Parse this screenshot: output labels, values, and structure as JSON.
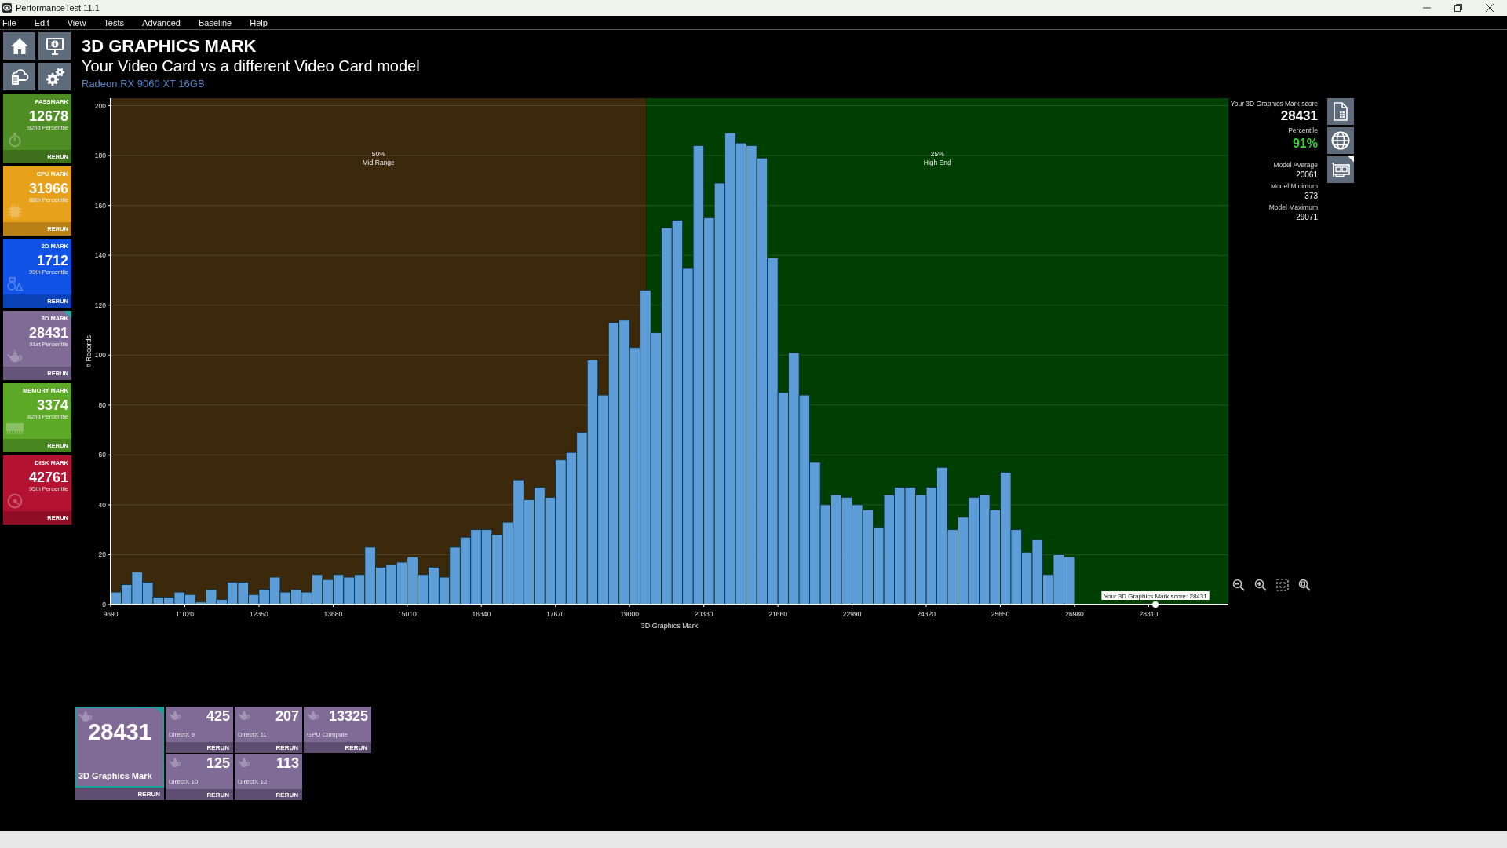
{
  "window": {
    "title": "PerformanceTest 11.1"
  },
  "menu": [
    "File",
    "Edit",
    "View",
    "Tests",
    "Advanced",
    "Baseline",
    "Help"
  ],
  "sidebar": {
    "tiles": [
      {
        "kind": "overall",
        "title": "PASSMARK",
        "score": "12678",
        "percentile": "92nd Percentile",
        "action": "RERUN",
        "color": "#4e8c24",
        "selected": false
      },
      {
        "kind": "cpu",
        "title": "CPU MARK",
        "score": "31966",
        "percentile": "88th Percentile",
        "action": "RERUN",
        "color": "#e8a11b",
        "selected": false
      },
      {
        "kind": "drawing",
        "title": "2D MARK",
        "score": "1712",
        "percentile": "99th Percentile",
        "action": "RERUN",
        "color": "#1053e6",
        "selected": false
      },
      {
        "kind": "graphics",
        "title": "3D MARK",
        "score": "28431",
        "percentile": "91st Percentile",
        "action": "RERUN",
        "color": "#7f6b96",
        "selected": true
      },
      {
        "kind": "memory",
        "title": "MEMORY MARK",
        "score": "3374",
        "percentile": "82nd Percentile",
        "action": "RERUN",
        "color": "#5ca827",
        "selected": false
      },
      {
        "kind": "disk",
        "title": "DISK MARK",
        "score": "42761",
        "percentile": "95th Percentile",
        "action": "RERUN",
        "color": "#b31230",
        "selected": false
      }
    ]
  },
  "header": {
    "title": "3D GRAPHICS MARK",
    "subtitle": "Your Video Card vs a different Video Card model",
    "device": "Radeon RX 9060 XT 16GB"
  },
  "chart": {
    "chart_data": {
      "type": "histogram",
      "xlabel": "3D Graphics Mark",
      "ylabel": "# Records",
      "bins": [
        9690,
        9880,
        10070,
        10260,
        10450,
        10640,
        10830,
        11020,
        11210,
        11400,
        11590,
        11780,
        11970,
        12160,
        12350,
        12540,
        12730,
        12920,
        13110,
        13300,
        13490,
        13680,
        13870,
        14060,
        14250,
        14440,
        14630,
        14820,
        15010,
        15200,
        15390,
        15580,
        15770,
        15960,
        16150,
        16340,
        16530,
        16720,
        16910,
        17100,
        17290,
        17480,
        17670,
        17860,
        18050,
        18240,
        18430,
        18620,
        18810,
        19000,
        19190,
        19380,
        19570,
        19760,
        19950,
        20140,
        20330,
        20520,
        20710,
        20900,
        21090,
        21280,
        21470,
        21660,
        21850,
        22040,
        22230,
        22420,
        22610,
        22800,
        22990,
        23180,
        23370,
        23560,
        23750,
        23940,
        24130,
        24320,
        24510,
        24700,
        24890,
        25080,
        25270,
        25460,
        25650,
        25840,
        26030,
        26220,
        26410,
        26600,
        26790,
        26980
      ],
      "values": [
        5,
        8,
        13,
        9,
        3,
        3,
        5,
        4,
        1,
        6,
        2,
        9,
        9,
        4,
        6,
        11,
        5,
        6,
        5,
        12,
        10,
        12,
        11,
        12,
        23,
        15,
        16,
        17,
        19,
        12,
        15,
        11,
        23,
        27,
        30,
        30,
        28,
        33,
        50,
        42,
        47,
        43,
        58,
        61,
        69,
        98,
        84,
        113,
        114,
        103,
        126,
        109,
        151,
        154,
        135,
        184,
        155,
        169,
        189,
        185,
        184,
        179,
        139,
        85,
        101,
        84,
        57,
        40,
        44,
        43,
        40,
        38,
        31,
        44,
        47,
        47,
        44,
        47,
        55,
        30,
        35,
        43,
        44,
        38,
        53,
        30,
        21,
        26,
        12,
        20,
        19
      ],
      "color": "#5d9dd8",
      "xlim": [
        9690,
        29740
      ],
      "ylim": [
        0,
        203
      ],
      "xticks": [
        9690,
        11020,
        12350,
        13680,
        15010,
        16340,
        17670,
        19000,
        20330,
        21660,
        22990,
        24320,
        25650,
        26980,
        28310
      ],
      "yticks": [
        0,
        20,
        40,
        60,
        80,
        100,
        120,
        140,
        160,
        180,
        200
      ],
      "grid": true,
      "bands": [
        {
          "axis": "x",
          "from": 9690,
          "to": 19300,
          "label": "50%\nMid Range",
          "color": "#3c290c"
        },
        {
          "axis": "x",
          "from": 19300,
          "to": 29740,
          "label": "25%\nHigh End",
          "color": "#003f02"
        }
      ],
      "series": [
        {
          "type": "scatter",
          "x": [
            28431
          ],
          "values": [
            0
          ],
          "color": "#ffffff"
        }
      ],
      "annotations": [
        "Your 3D Graphics Mark score: 28431"
      ]
    }
  },
  "score_panel": {
    "score_label": "Your 3D Graphics Mark score",
    "score": "28431",
    "percentile_label": "Percentile",
    "percentile": "91%",
    "stats": [
      {
        "label": "Model Average",
        "value": "20061"
      },
      {
        "label": "Model Minimum",
        "value": "373"
      },
      {
        "label": "Model Maximum",
        "value": "29071"
      }
    ],
    "buttons": [
      {
        "kind": "report",
        "selected": false
      },
      {
        "kind": "globe",
        "selected": false
      },
      {
        "kind": "card",
        "selected": true
      }
    ]
  },
  "sub_scores": [
    {
      "kind": "main",
      "score": "28431",
      "label": "3D Graphics Mark",
      "action": "RERUN",
      "selected": true
    },
    {
      "kind": "test",
      "score": "425",
      "label": "DirectX 9",
      "action": "RERUN",
      "selected": false
    },
    {
      "kind": "test",
      "score": "207",
      "label": "DirectX 11",
      "action": "RERUN",
      "selected": false
    },
    {
      "kind": "test",
      "score": "13325",
      "label": "GPU Compute",
      "action": "RERUN",
      "selected": false
    },
    {
      "kind": "test",
      "score": "125",
      "label": "DirectX 10",
      "action": "RERUN",
      "selected": false
    },
    {
      "kind": "test",
      "score": "113",
      "label": "DirectX 12",
      "action": "RERUN",
      "selected": false
    }
  ]
}
